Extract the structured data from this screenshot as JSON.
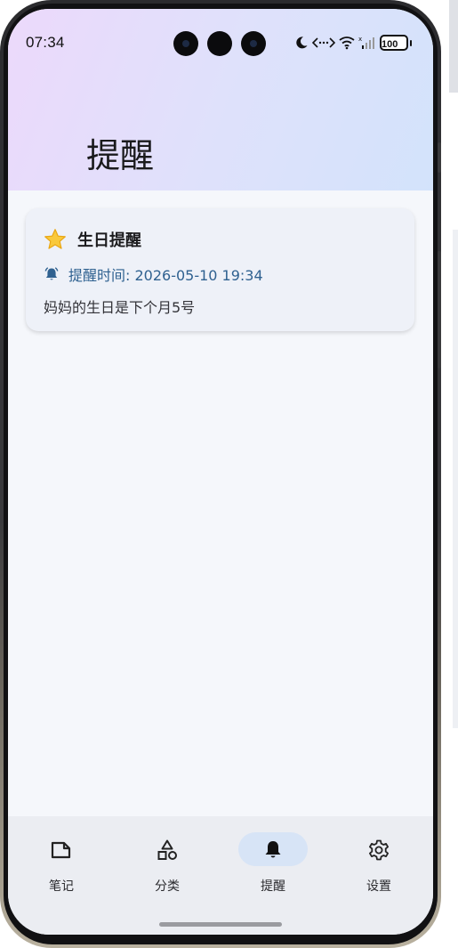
{
  "status_bar": {
    "time": "07:34",
    "icons": [
      "moon-icon",
      "data-transfer-icon",
      "wifi-icon",
      "signal-icon"
    ],
    "battery": "100"
  },
  "header": {
    "title": "提醒",
    "gradient_colors": [
      "#ecd9fb",
      "#d3e3fb"
    ]
  },
  "reminders": [
    {
      "icon": "star-icon",
      "title": "生日提醒",
      "time_label": "提醒时间: 2026-05-10 19:34",
      "note": "妈妈的生日是下个月5号"
    }
  ],
  "bottom_nav": {
    "items": [
      {
        "label": "笔记",
        "icon": "note-icon",
        "active": false
      },
      {
        "label": "分类",
        "icon": "category-icon",
        "active": false
      },
      {
        "label": "提醒",
        "icon": "bell-icon",
        "active": true
      },
      {
        "label": "设置",
        "icon": "settings-icon",
        "active": false
      }
    ]
  },
  "colors": {
    "accent": "#2f6190",
    "active_pill": "#d7e4f6",
    "card_bg": "#eef1f8",
    "page_bg": "#f5f7fb"
  }
}
